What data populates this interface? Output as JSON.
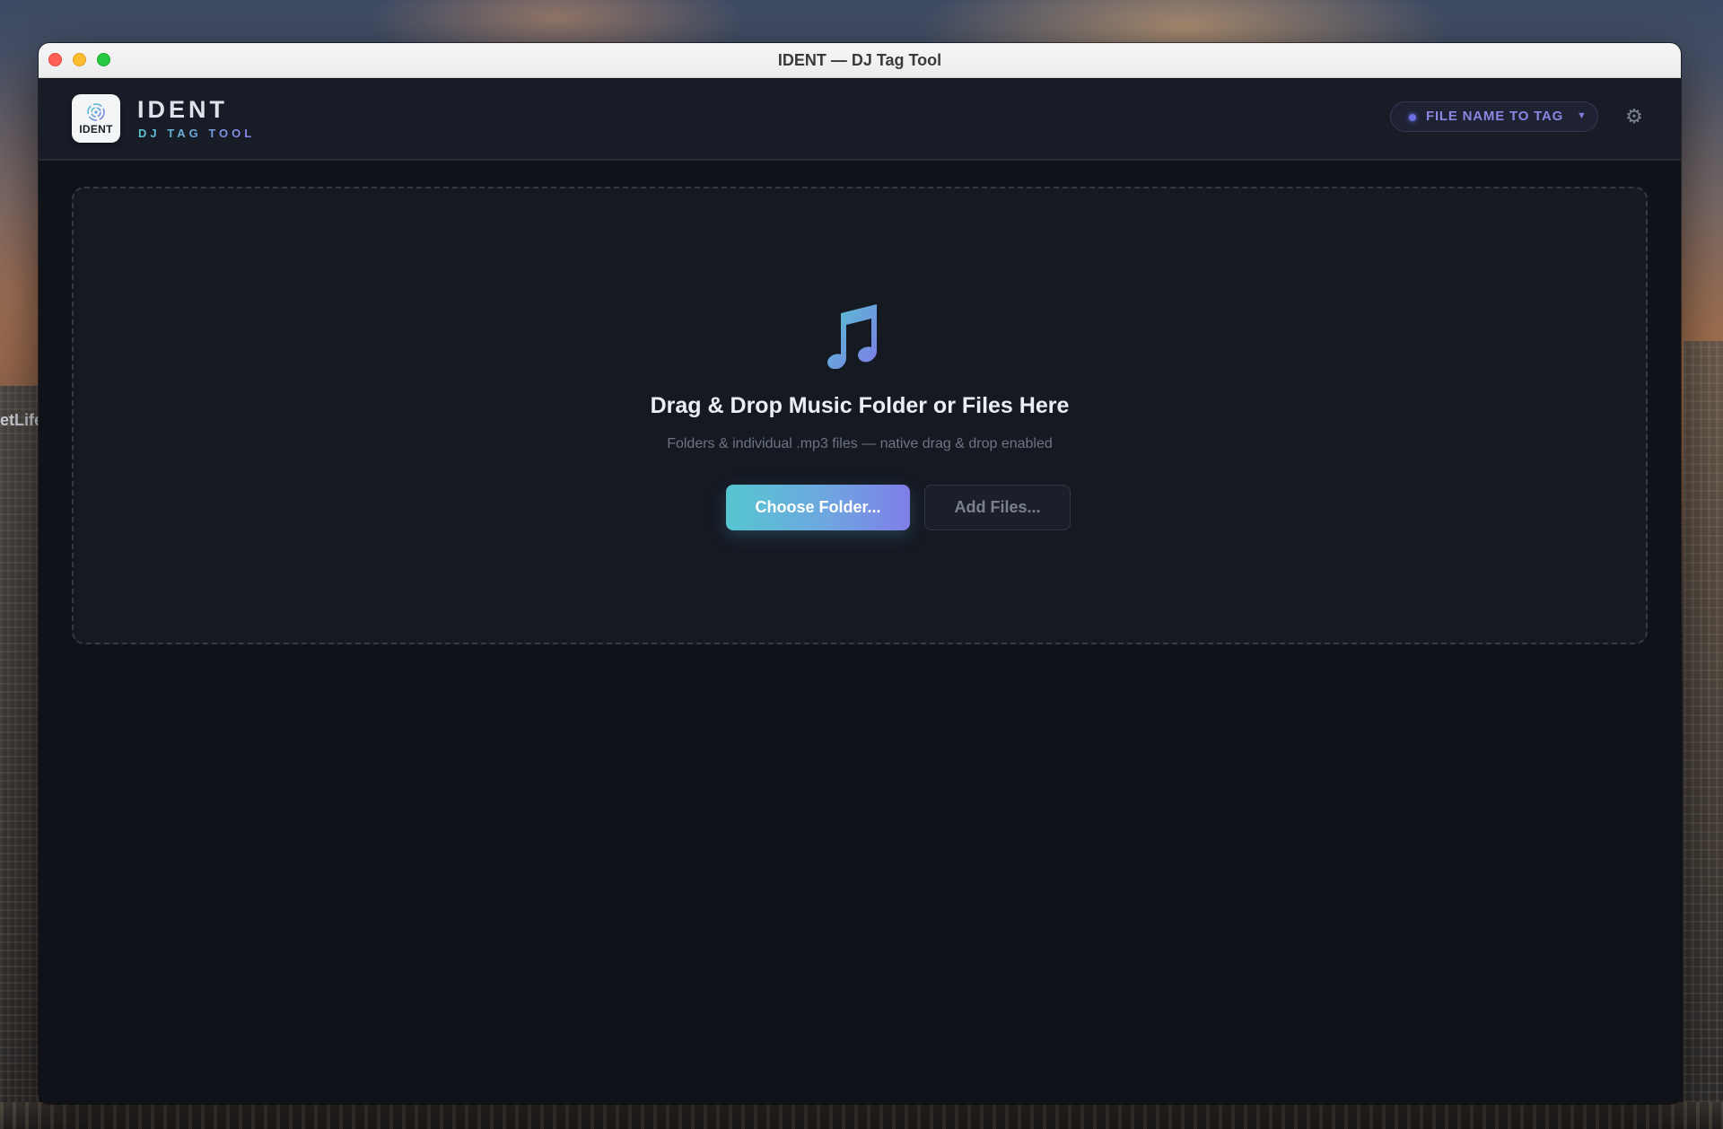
{
  "window": {
    "title": "IDENT — DJ Tag Tool"
  },
  "desktop": {
    "sign_text": "etLife"
  },
  "header": {
    "logo_text": "IDENT",
    "brand_name": "IDENT",
    "brand_tagline": "DJ TAG TOOL",
    "mode_selector": {
      "label": "FILE NAME TO TAG",
      "caret": "▼"
    },
    "settings_icon": "gear-icon",
    "settings_glyph": "⚙"
  },
  "dropzone": {
    "icon": "music-note-icon",
    "title": "Drag & Drop Music Folder or Files Here",
    "subtitle": "Folders & individual .mp3 files — native drag & drop enabled",
    "primary_button": "Choose Folder...",
    "secondary_button": "Add Files..."
  },
  "colors": {
    "accent_teal": "#56c6d0",
    "accent_violet": "#7f7ee8",
    "background": "#0f1219",
    "header_background": "#181c27"
  }
}
